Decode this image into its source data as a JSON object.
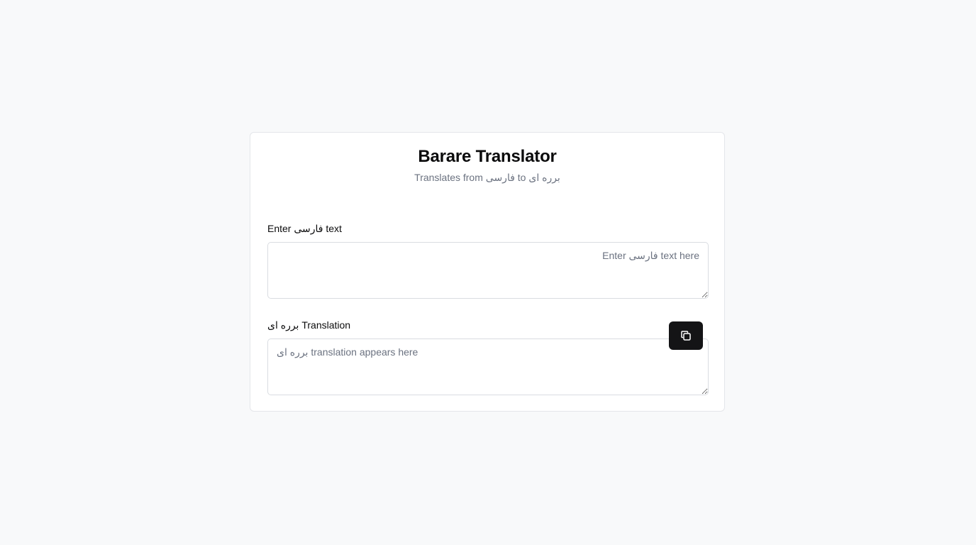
{
  "app": {
    "title": "Barare Translator",
    "subtitle": "Translates from فارسی to برره ای"
  },
  "source": {
    "label": "Enter فارسی text",
    "placeholder": "Enter فارسی text here",
    "value": ""
  },
  "target": {
    "label": "برره ای Translation",
    "placeholder": "برره ای translation appears here",
    "value": ""
  },
  "copy_button": {
    "icon": "copy-icon"
  },
  "colors": {
    "background": "#f8f9fa",
    "card": "#ffffff",
    "button": "#141416",
    "muted_text": "#6b7280"
  }
}
